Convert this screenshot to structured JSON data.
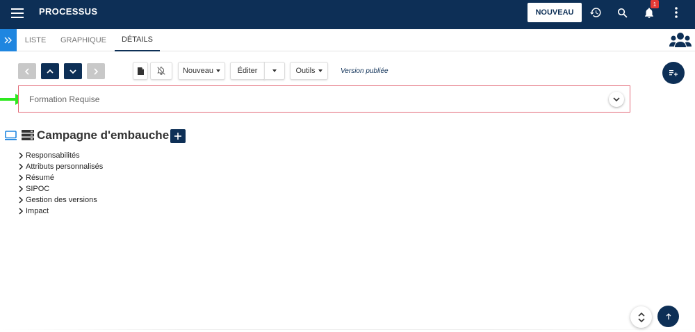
{
  "header": {
    "app_title": "PROCESSUS",
    "new_button": "NOUVEAU",
    "notification_count": "1",
    "icons": [
      "menu-icon",
      "history-icon",
      "search-icon",
      "bell-icon",
      "more-vert-icon"
    ]
  },
  "tabs": [
    {
      "label": "LISTE",
      "active": false
    },
    {
      "label": "GRAPHIQUE",
      "active": false
    },
    {
      "label": "DÉTAILS",
      "active": true
    }
  ],
  "toolbar": {
    "new_label": "Nouveau",
    "edit_label": "Éditer",
    "tools_label": "Outils",
    "version_label": "Version publiée"
  },
  "collapsible": {
    "title": "Formation Requise"
  },
  "process": {
    "title": "Campagne d'embauche"
  },
  "sections": [
    {
      "label": "Responsabilités"
    },
    {
      "label": "Attributs personnalisés"
    },
    {
      "label": "Résumé"
    },
    {
      "label": "SIPOC"
    },
    {
      "label": "Gestion des versions"
    },
    {
      "label": "Impact"
    }
  ],
  "colors": {
    "primary": "#0d2f56",
    "accent_blue": "#1f86e0",
    "highlight_border": "#e26a78",
    "arrow_green": "#2ee81f",
    "badge_red": "#e53935"
  }
}
